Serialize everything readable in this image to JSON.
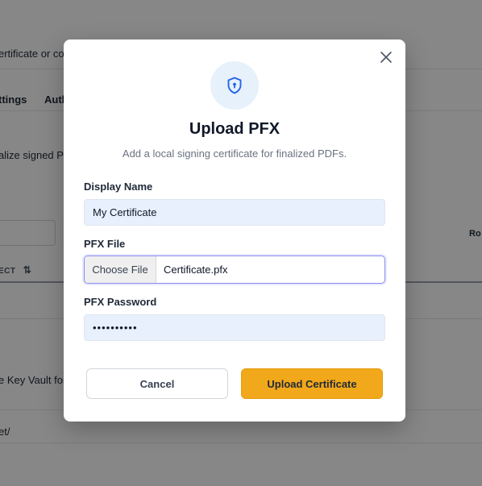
{
  "background": {
    "line1": "ertificate or co",
    "tab1": "ttings",
    "tab2": "Auth",
    "line2": "alize signed P",
    "right_label": "Ro",
    "column_header": "ECT",
    "line3": "e Key Vault for",
    "line4": "et/"
  },
  "modal": {
    "title": "Upload PFX",
    "subtitle": "Add a local signing certificate for finalized PDFs.",
    "display_name": {
      "label": "Display Name",
      "value": "My Certificate"
    },
    "pfx_file": {
      "label": "PFX File",
      "button": "Choose File",
      "filename": "Certificate.pfx"
    },
    "pfx_password": {
      "label": "PFX Password",
      "value": "••••••••••"
    },
    "cancel_label": "Cancel",
    "upload_label": "Upload Certificate"
  },
  "icons": {
    "close": "close-icon",
    "shield": "shield-keyhole-icon",
    "sort": "sort-arrows-icon"
  },
  "colors": {
    "accent": "#f2a81b",
    "icon_blue": "#2563eb",
    "icon_bg": "#e6f1fb",
    "field_bg": "#e8f0fe"
  }
}
